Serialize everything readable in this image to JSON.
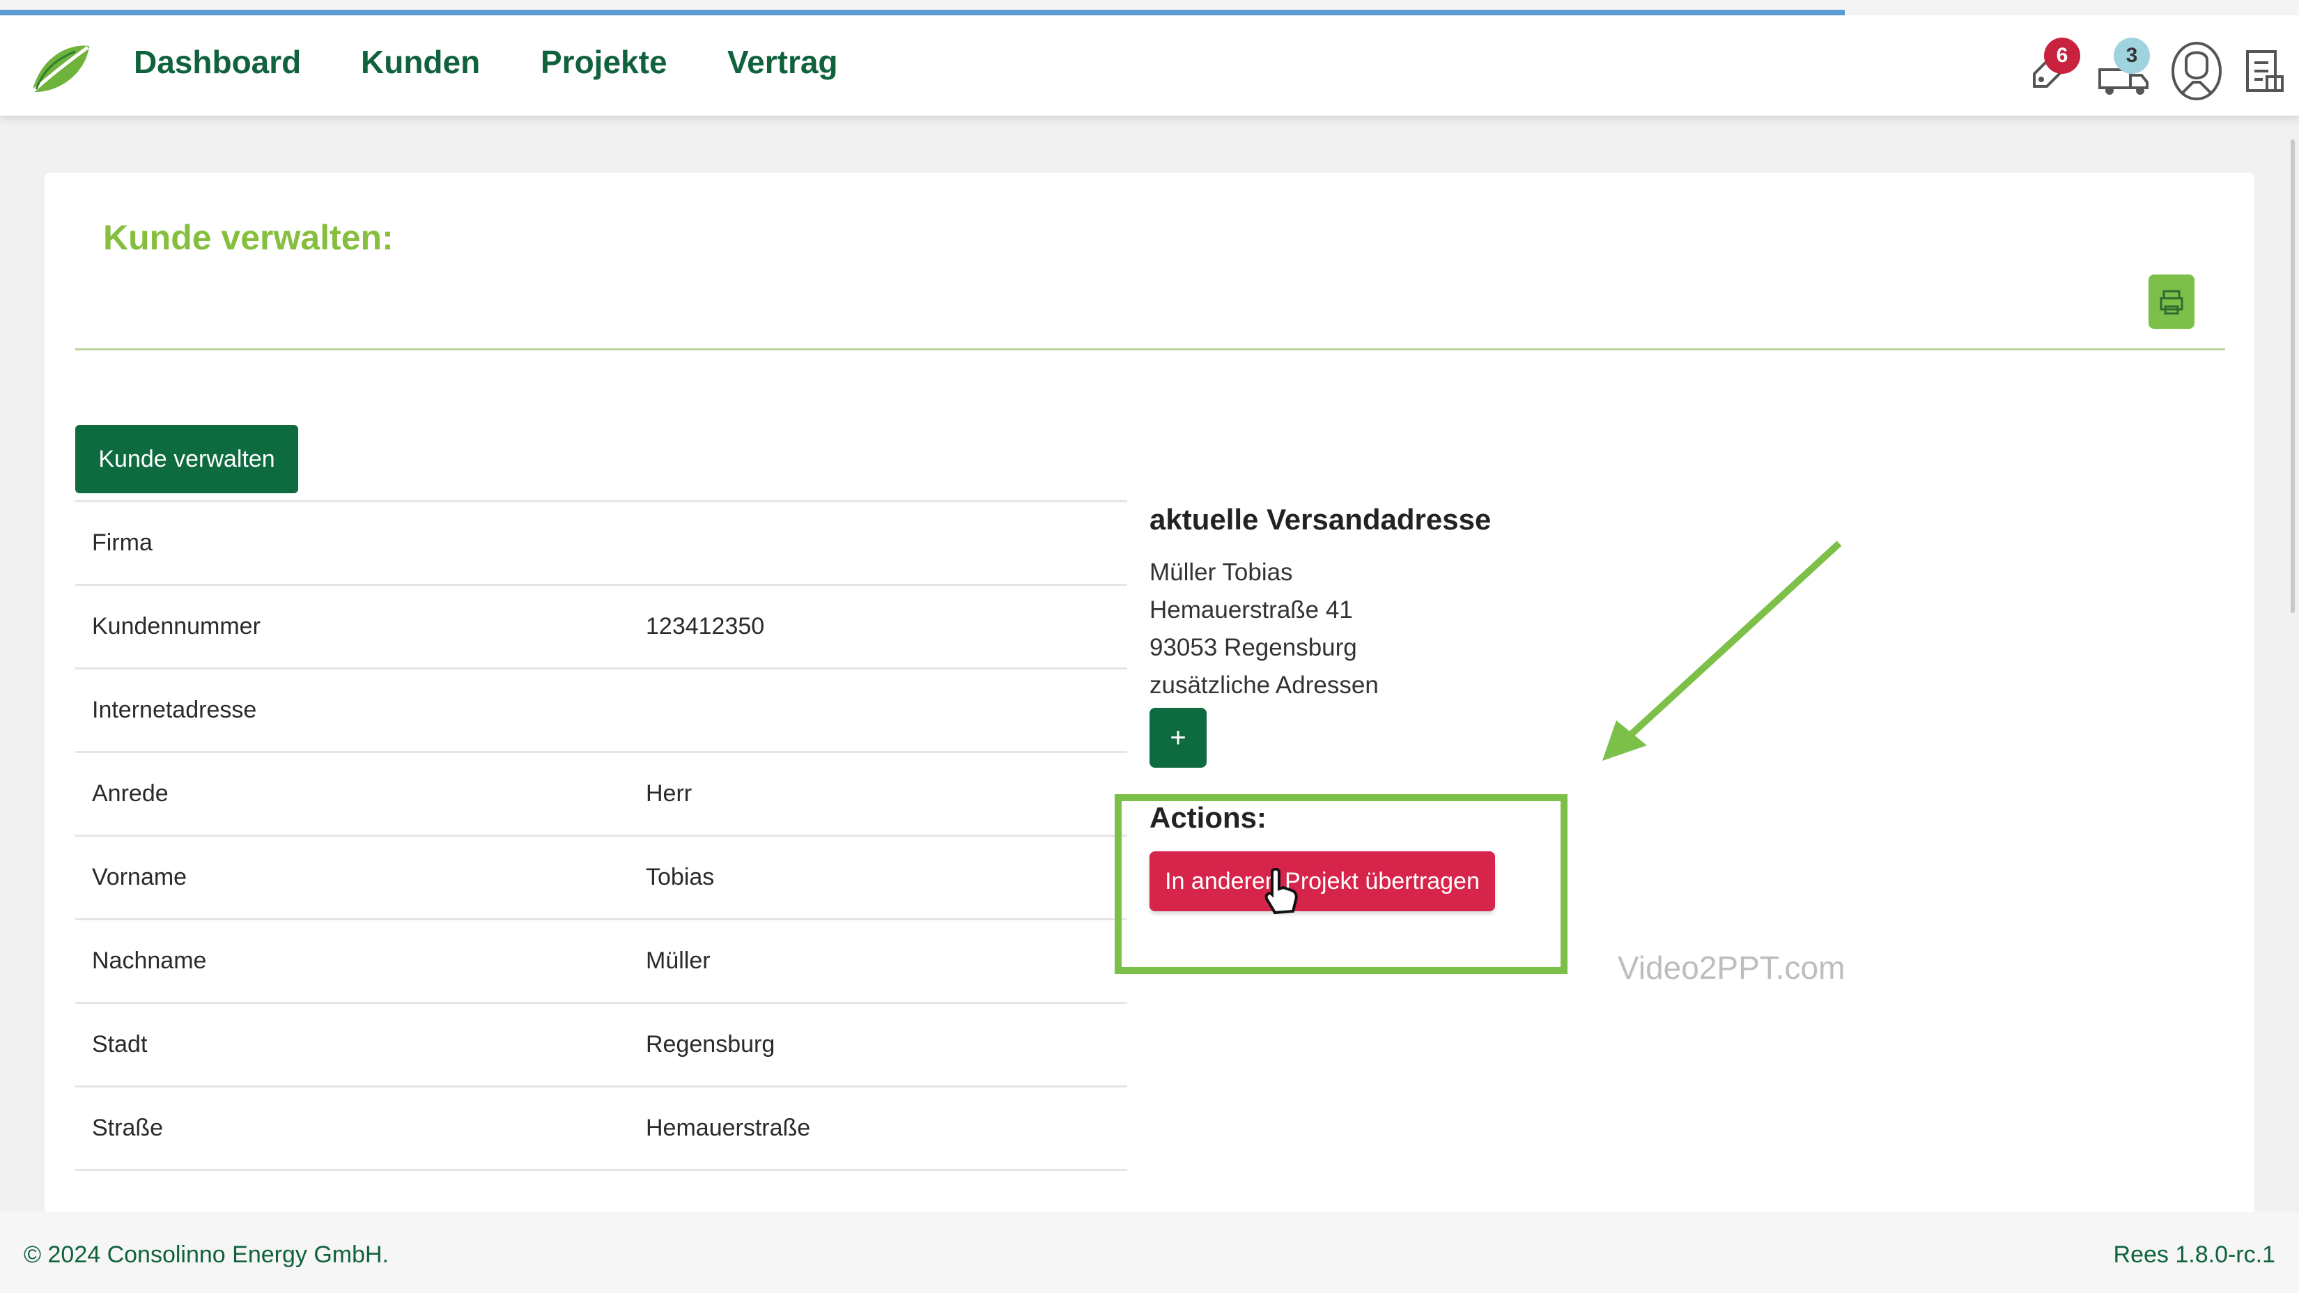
{
  "nav": {
    "items": [
      "Dashboard",
      "Kunden",
      "Projekte",
      "Vertrag"
    ],
    "notifications_count": "6",
    "messages_count": "3"
  },
  "card": {
    "title": "Kunde verwalten:",
    "manage_button": "Kunde verwalten",
    "fields": [
      {
        "label": "Firma",
        "value": ""
      },
      {
        "label": "Kundennummer",
        "value": "123412350"
      },
      {
        "label": "Internetadresse",
        "value": ""
      },
      {
        "label": "Anrede",
        "value": "Herr"
      },
      {
        "label": "Vorname",
        "value": "Tobias"
      },
      {
        "label": "Nachname",
        "value": "Müller"
      },
      {
        "label": "Stadt",
        "value": "Regensburg"
      },
      {
        "label": "Straße",
        "value": "Hemauerstraße"
      }
    ]
  },
  "shipping": {
    "title": "aktuelle Versandadresse",
    "name": "Müller Tobias",
    "street": "Hemauerstraße 41",
    "city": "93053 Regensburg",
    "extra_label": "zusätzliche Adressen",
    "add_label": "+"
  },
  "actions": {
    "title": "Actions:",
    "transfer_button": "In anderen Projekt übertragen"
  },
  "watermark": "Video2PPT.com",
  "footer": {
    "copyright": "© 2024 Consolinno Energy GmbH.",
    "version": "Rees 1.8.0-rc.1"
  },
  "colors": {
    "brand_green": "#10623d",
    "accent_green": "#86bf3e",
    "danger": "#d6244a",
    "highlight": "#7cc04a"
  }
}
